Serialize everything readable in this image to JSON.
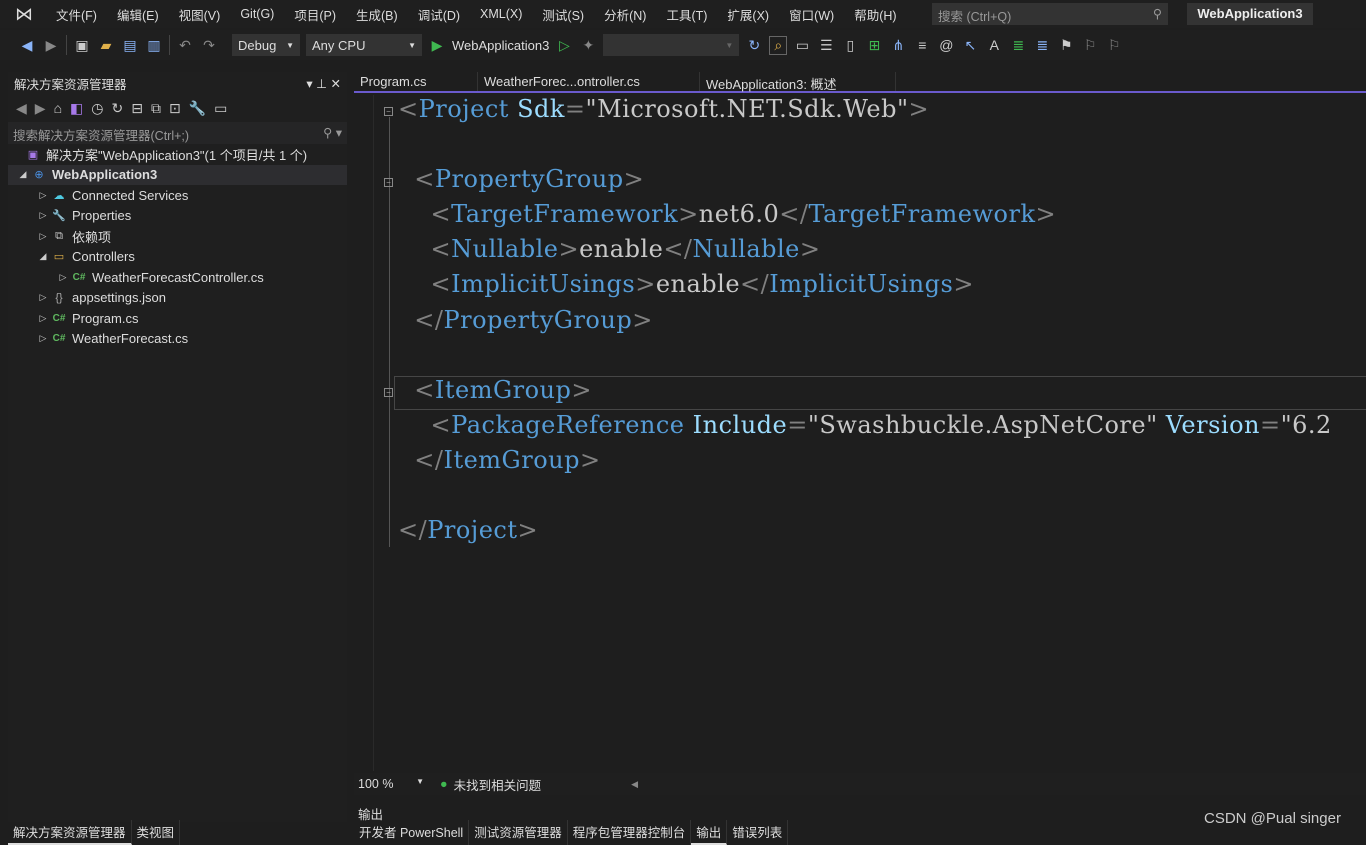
{
  "menubar": {
    "items": [
      "文件(F)",
      "编辑(E)",
      "视图(V)",
      "Git(G)",
      "项目(P)",
      "生成(B)",
      "调试(D)",
      "XML(X)",
      "测试(S)",
      "分析(N)",
      "工具(T)",
      "扩展(X)",
      "窗口(W)",
      "帮助(H)"
    ],
    "search_placeholder": "搜索 (Ctrl+Q)",
    "title": "WebApplication3"
  },
  "toolbar": {
    "config": "Debug",
    "platform": "Any CPU",
    "run_target": "WebApplication3"
  },
  "solution_explorer": {
    "title": "解决方案资源管理器",
    "search_placeholder": "搜索解决方案资源管理器(Ctrl+;)",
    "solution": "解决方案\"WebApplication3\"(1 个项目/共 1 个)",
    "project": "WebApplication3",
    "items": [
      {
        "label": "Connected Services",
        "icon": "cloud-icon"
      },
      {
        "label": "Properties",
        "icon": "wrench-icon"
      },
      {
        "label": "依赖项",
        "icon": "dependencies-icon"
      },
      {
        "label": "Controllers",
        "icon": "folder-icon"
      },
      {
        "label": "WeatherForecastController.cs",
        "icon": "csharp-icon"
      },
      {
        "label": "appsettings.json",
        "icon": "json-icon"
      },
      {
        "label": "Program.cs",
        "icon": "csharp-icon"
      },
      {
        "label": "WeatherForecast.cs",
        "icon": "csharp-icon"
      }
    ],
    "bottom_tabs": [
      "解决方案资源管理器",
      "类视图"
    ]
  },
  "editor": {
    "tabs": [
      "Program.cs",
      "WeatherForec...ontroller.cs",
      "WebApplication3: 概述"
    ],
    "code": {
      "project_open": "Project",
      "sdk_attr": "Sdk",
      "sdk_val": "\"Microsoft.NET.Sdk.Web\"",
      "pg": "PropertyGroup",
      "tf": "TargetFramework",
      "tf_val": "net6.0",
      "nl": "Nullable",
      "nl_val": "enable",
      "iu": "ImplicitUsings",
      "iu_val": "enable",
      "ig": "ItemGroup",
      "pr": "PackageReference",
      "inc": "Include",
      "inc_val": "\"Swashbuckle.AspNetCore\"",
      "ver": "Version",
      "ver_val": "\"6.2"
    },
    "zoom": "100 %",
    "status": "未找到相关问题"
  },
  "output": {
    "label": "输出",
    "tabs": [
      "开发者 PowerShell",
      "测试资源管理器",
      "程序包管理器控制台",
      "输出",
      "错误列表"
    ],
    "active": "输出"
  },
  "watermark": "CSDN @Pual singer"
}
